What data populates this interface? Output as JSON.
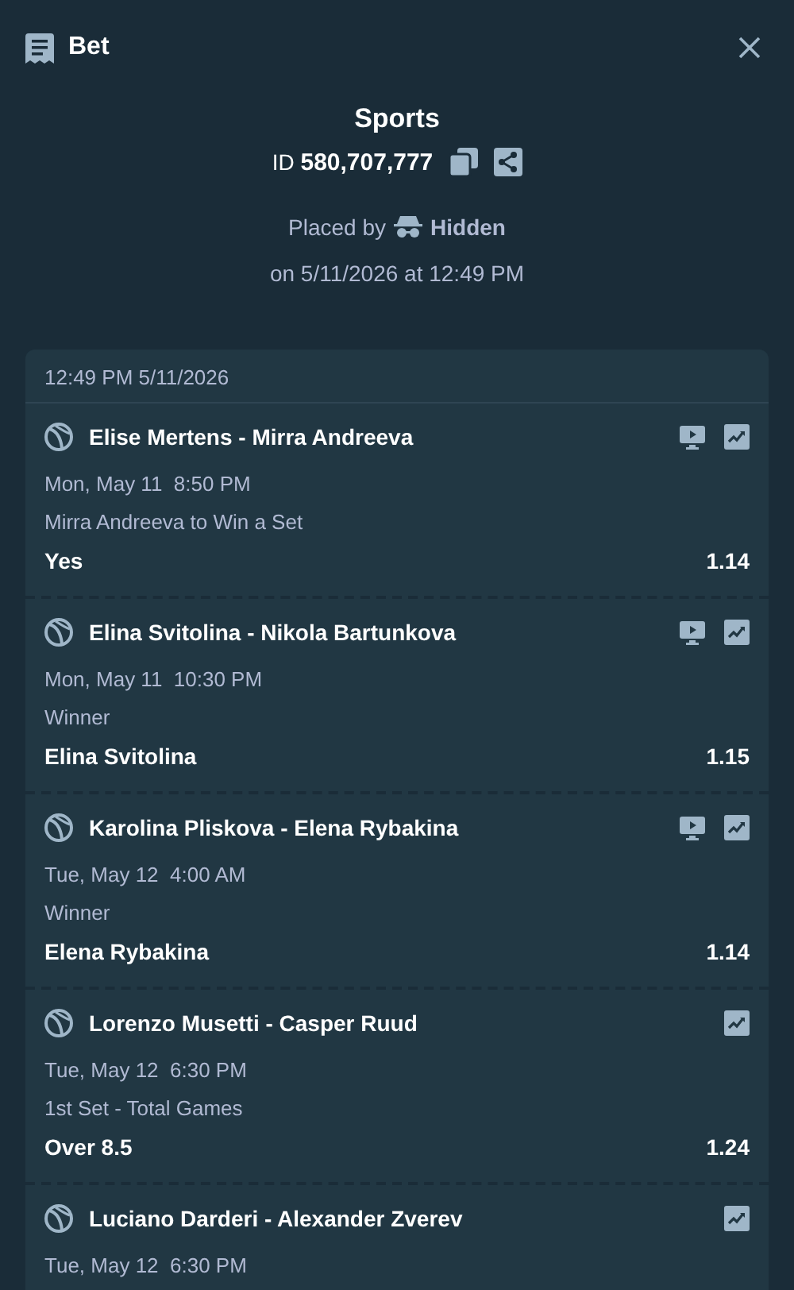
{
  "header": {
    "title": "Bet"
  },
  "summary": {
    "title": "Sports",
    "id_label": "ID",
    "id_value": "580,707,777",
    "placed_by_label": "Placed by",
    "placed_by": "Hidden",
    "placed_on": "on 5/11/2026 at 12:49 PM"
  },
  "slip": {
    "timestamp": "12:49 PM 5/11/2026",
    "legs": [
      {
        "event": "Elise Mertens - Mirra Andreeva",
        "live_stream": true,
        "date": "Mon, May 11",
        "time": "8:50 PM",
        "market": "Mirra Andreeva to Win a Set",
        "selection": "Yes",
        "odds": "1.14"
      },
      {
        "event": "Elina Svitolina - Nikola Bartunkova",
        "live_stream": true,
        "date": "Mon, May 11",
        "time": "10:30 PM",
        "market": "Winner",
        "selection": "Elina Svitolina",
        "odds": "1.15"
      },
      {
        "event": "Karolina Pliskova - Elena Rybakina",
        "live_stream": true,
        "date": "Tue, May 12",
        "time": "4:00 AM",
        "market": "Winner",
        "selection": "Elena Rybakina",
        "odds": "1.14"
      },
      {
        "event": "Lorenzo Musetti - Casper Ruud",
        "live_stream": false,
        "date": "Tue, May 12",
        "time": "6:30 PM",
        "market": "1st Set - Total Games",
        "selection": "Over 8.5",
        "odds": "1.24"
      },
      {
        "event": "Luciano Darderi - Alexander Zverev",
        "live_stream": false,
        "date": "Tue, May 12",
        "time": "6:30 PM"
      }
    ]
  }
}
